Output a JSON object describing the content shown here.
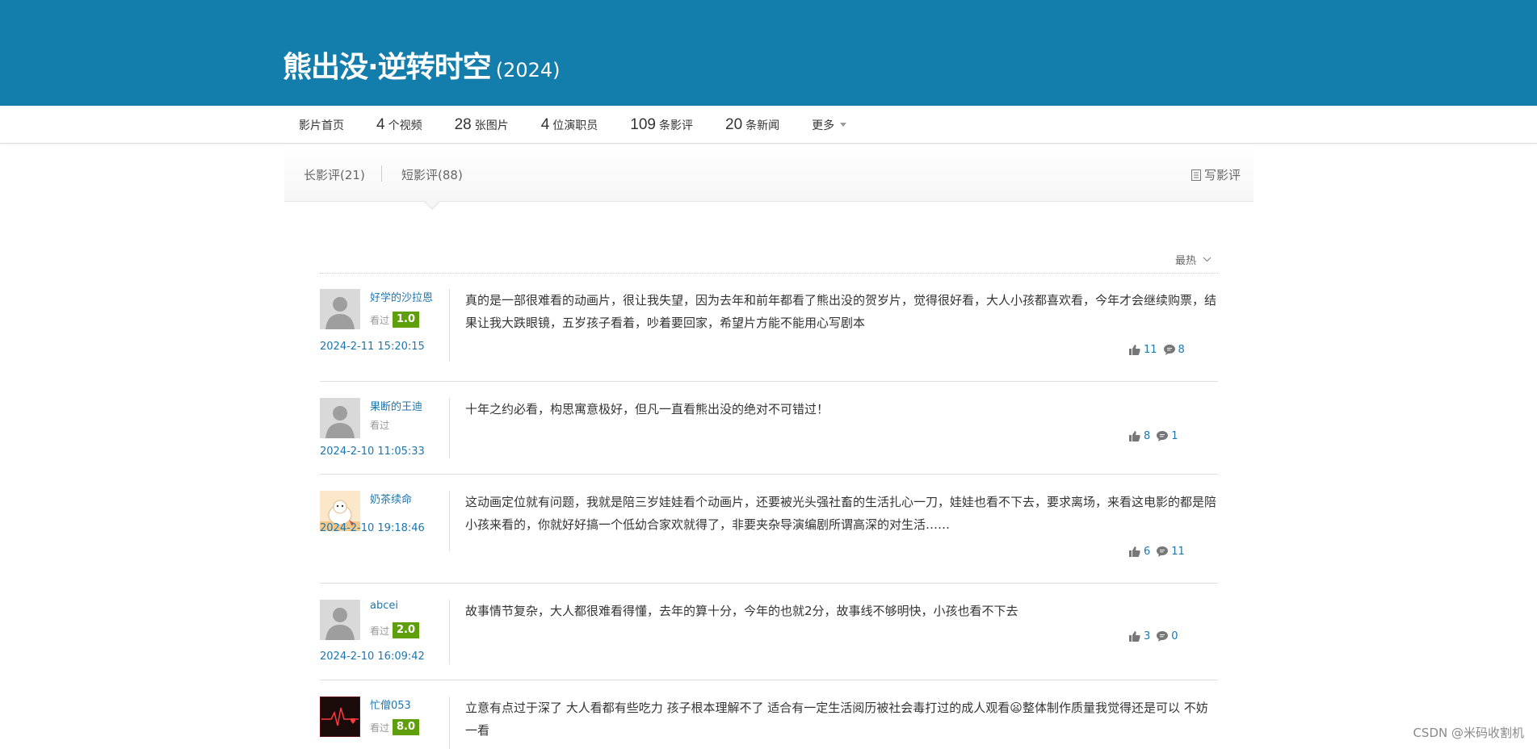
{
  "header": {
    "title": "熊出没·逆转时空",
    "year": "(2024)",
    "bg_color": "#137dab"
  },
  "nav": {
    "home": "影片首页",
    "items": [
      {
        "num": "4",
        "label": "个视频"
      },
      {
        "num": "28",
        "label": "张图片"
      },
      {
        "num": "4",
        "label": "位演职员"
      },
      {
        "num": "109",
        "label": "条影评"
      },
      {
        "num": "20",
        "label": "条新闻"
      }
    ],
    "more": "更多"
  },
  "subnav": {
    "long_reviews": "长影评(21)",
    "short_reviews": "短影评(88)",
    "write_review": "写影评"
  },
  "sort": {
    "label": "最热"
  },
  "reviews": [
    {
      "username": "好学的沙拉恩",
      "watched": "看过",
      "score": "1.0",
      "date": "2024-2-11 15:20:15",
      "content": "真的是一部很难看的动画片，很让我失望，因为去年和前年都看了熊出没的贺岁片，觉得很好看，大人小孩都喜欢看，今年才会继续购票，结果让我大跌眼镜，五岁孩子看着，吵着要回家，希望片方能不能用心写剧本",
      "likes": "11",
      "comments": "8",
      "avatar": "default"
    },
    {
      "username": "果断的王迪",
      "watched": "看过",
      "score": "",
      "date": "2024-2-10 11:05:33",
      "content": "十年之约必看，构思寓意极好，但凡一直看熊出没的绝对不可错过！",
      "likes": "8",
      "comments": "1",
      "avatar": "default"
    },
    {
      "username": "奶茶续命",
      "watched": "",
      "score": "",
      "date": "2024-2-10 19:18:46",
      "content": "这动画定位就有问题，我就是陪三岁娃娃看个动画片，还要被光头强社畜的生活扎心一刀，娃娃也看不下去，要求离场，来看这电影的都是陪小孩来看的，你就好好搞一个低幼合家欢就得了，非要夹杂导演编剧所谓高深的对生活……",
      "likes": "6",
      "comments": "11",
      "avatar": "cartoon"
    },
    {
      "username": "abcei",
      "watched": "看过",
      "score": "2.0",
      "date": "2024-2-10 16:09:42",
      "content": "故事情节复杂，大人都很难看得懂，去年的算十分，今年的也就2分，故事线不够明快，小孩也看不下去",
      "likes": "3",
      "comments": "0",
      "avatar": "default"
    },
    {
      "username": "忙僧053",
      "watched": "看过",
      "score": "8.0",
      "date": "",
      "content": "立意有点过于深了 大人看都有些吃力 孩子根本理解不了 适合有一定生活阅历被社会毒打过的成人观看😦整体制作质量我觉得还是可以 不妨一看",
      "likes": "",
      "comments": "",
      "avatar": "heart"
    }
  ],
  "watermark": "CSDN @米码收割机",
  "colors": {
    "link": "#1d76ae",
    "score_bg": "#5e9f0b"
  }
}
